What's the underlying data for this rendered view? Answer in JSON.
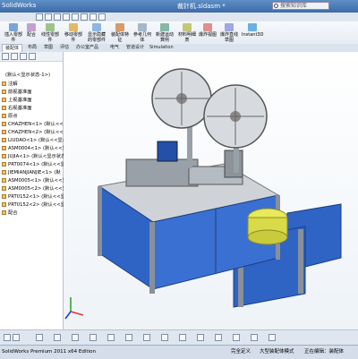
{
  "titlebar": {
    "app_name": "SolidWorks",
    "document_title": "裁针机.sldasm *",
    "search_placeholder": "搜索知识库"
  },
  "ribbon": {
    "buttons": [
      {
        "label": "插入零部件"
      },
      {
        "label": "配合"
      },
      {
        "label": "线性零部件"
      },
      {
        "label": "移动零部件"
      },
      {
        "label": "显示隐藏的零部件"
      },
      {
        "label": "装配体特征"
      },
      {
        "label": "参考几何体"
      },
      {
        "label": "新建运动算例"
      },
      {
        "label": "材料明细表"
      },
      {
        "label": "爆炸视图"
      },
      {
        "label": "爆炸直线草图"
      },
      {
        "label": "Instant3D"
      }
    ]
  },
  "tabs": [
    {
      "label": "装配体"
    },
    {
      "label": "布局"
    },
    {
      "label": "草图"
    },
    {
      "label": "评估"
    },
    {
      "label": "办公室产品"
    },
    {
      "label": "电气"
    },
    {
      "label": "管道设计"
    },
    {
      "label": "Simulation"
    }
  ],
  "tree": {
    "root_suffix": "(默认<显示状态-1>)",
    "items": [
      {
        "label": "注解"
      },
      {
        "label": "前视基准面"
      },
      {
        "label": "上视基准面"
      },
      {
        "label": "右视基准面"
      },
      {
        "label": "原点"
      },
      {
        "label": "CHAZHEN<1> (默认<<显"
      },
      {
        "label": "CHAZHEN<2> (默认<<显"
      },
      {
        "label": "LIUDAO<1> (默认<<显示"
      },
      {
        "label": "ASM0004<1> (默认<<显"
      },
      {
        "label": "JUJIA<1> (默认<显示状态"
      },
      {
        "label": "PRT0074<1> (默认<<显"
      },
      {
        "label": "JIEMIANJIANJIE<1> (默"
      },
      {
        "label": "ASM0005<1> (默认<<显"
      },
      {
        "label": "ASM0005<2> (默认<<显"
      },
      {
        "label": "PRT0152<1> (默认<<显"
      },
      {
        "label": "PRT0152<2> (默认<<显"
      },
      {
        "label": "配合"
      }
    ]
  },
  "status": {
    "product": "SolidWorks Premium 2011 x64 Edition",
    "state": "完全定义",
    "mode": "大型装配体模式",
    "edit": "正在编辑：装配体"
  },
  "colors": {
    "frame_blue": "#2f63c4",
    "table_top": "#cfd3d8",
    "feeder_yellow": "#e9ea5a"
  }
}
